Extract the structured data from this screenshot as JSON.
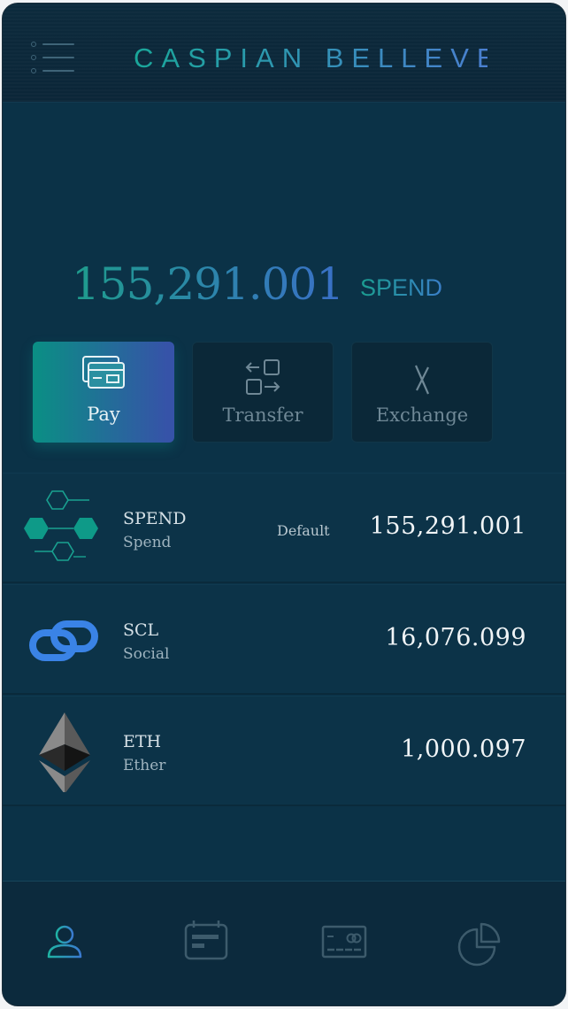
{
  "header": {
    "title": "CASPIAN BELLEVE",
    "menu_icon": "menu-icon"
  },
  "balance": {
    "amount": "155,291.001",
    "unit": "SPEND"
  },
  "actions": [
    {
      "label": "Pay",
      "icon": "card-icon",
      "active": true
    },
    {
      "label": "Transfer",
      "icon": "transfer-icon",
      "active": false
    },
    {
      "label": "Exchange",
      "icon": "exchange-icon",
      "active": false
    }
  ],
  "assets": [
    {
      "symbol": "SPEND",
      "name": "Spend",
      "tag": "Default",
      "amount": "155,291.001",
      "icon": "hexagon-network-icon"
    },
    {
      "symbol": "SCL",
      "name": "Social",
      "tag": "",
      "amount": "16,076.099",
      "icon": "chain-link-icon"
    },
    {
      "symbol": "ETH",
      "name": "Ether",
      "tag": "",
      "amount": "1,000.097",
      "icon": "ethereum-icon"
    }
  ],
  "nav": [
    {
      "icon": "user-icon",
      "active": true
    },
    {
      "icon": "calendar-icon",
      "active": false
    },
    {
      "icon": "credit-card-icon",
      "active": false
    },
    {
      "icon": "pie-chart-icon",
      "active": false
    }
  ],
  "colors": {
    "accent_teal": "#1aa79a",
    "accent_blue": "#3a6fc8",
    "background": "#0b3247"
  }
}
